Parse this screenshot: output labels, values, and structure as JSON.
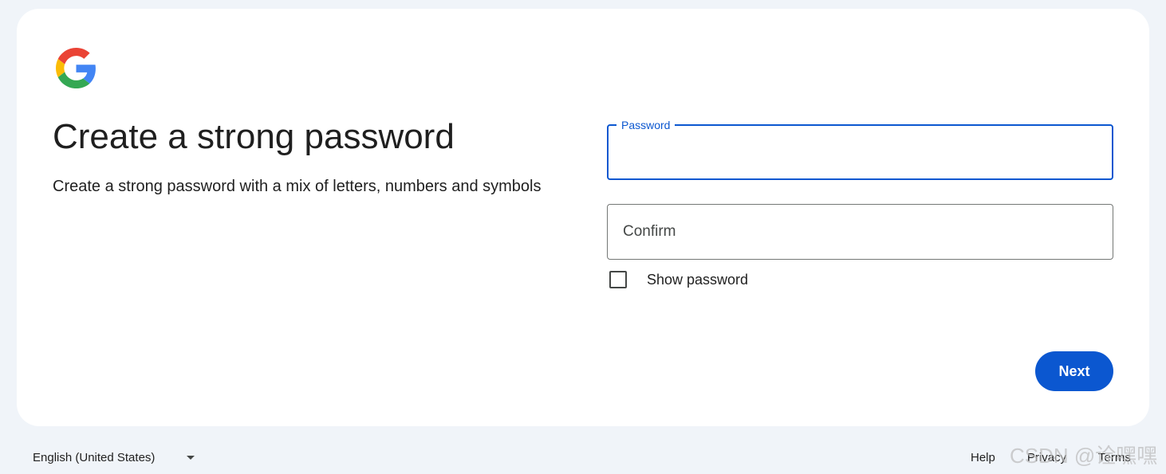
{
  "header": {
    "logo_icon": "google-g-icon",
    "title": "Create a strong password",
    "subtitle": "Create a strong password with a mix of letters, numbers and symbols"
  },
  "form": {
    "password_label": "Password",
    "password_value": "",
    "confirm_placeholder": "Confirm",
    "confirm_value": "",
    "show_password_label": "Show password",
    "show_password_checked": false,
    "next_label": "Next"
  },
  "footer": {
    "language": "English (United States)",
    "links": [
      "Help",
      "Privacy",
      "Terms"
    ]
  },
  "watermark": "CSDN @诠嘿嘿",
  "colors": {
    "accent": "#0b57d0",
    "background": "#f0f4f9",
    "card": "#ffffff",
    "text": "#1f1f1f"
  }
}
